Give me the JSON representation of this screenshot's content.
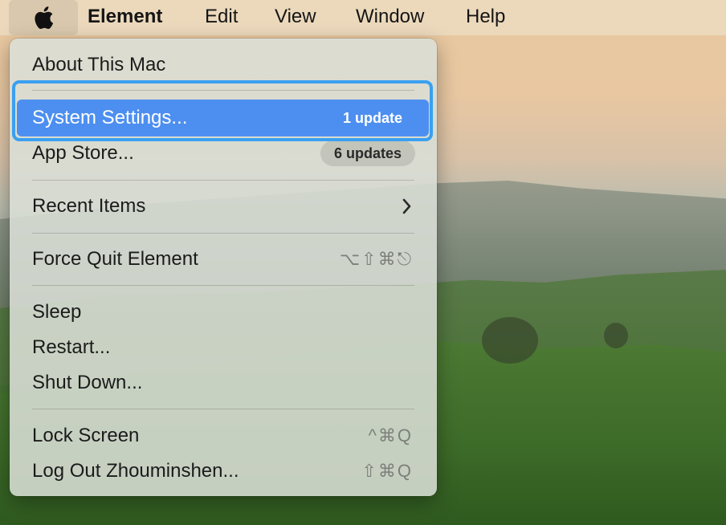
{
  "menubar": {
    "apple_icon": "apple-logo-icon",
    "items": [
      "Element",
      "Edit",
      "View",
      "Window",
      "Help"
    ]
  },
  "apple_menu": {
    "about": "About This Mac",
    "system_settings": {
      "label": "System Settings...",
      "badge": "1 update"
    },
    "app_store": {
      "label": "App Store...",
      "badge": "6 updates"
    },
    "recent_items": {
      "label": "Recent Items",
      "icon": "chevron-right-icon"
    },
    "force_quit": {
      "label": "Force Quit Element",
      "shortcut": "⌥⇧⌘⎋"
    },
    "sleep": "Sleep",
    "restart": "Restart...",
    "shut_down": "Shut Down...",
    "lock_screen": {
      "label": "Lock Screen",
      "shortcut": "^⌘Q"
    },
    "log_out": {
      "label": "Log Out Zhouminshen...",
      "shortcut": "⇧⌘Q"
    }
  },
  "colors": {
    "selection": "#4d8ff0",
    "focus_ring": "#3aa0f0"
  }
}
